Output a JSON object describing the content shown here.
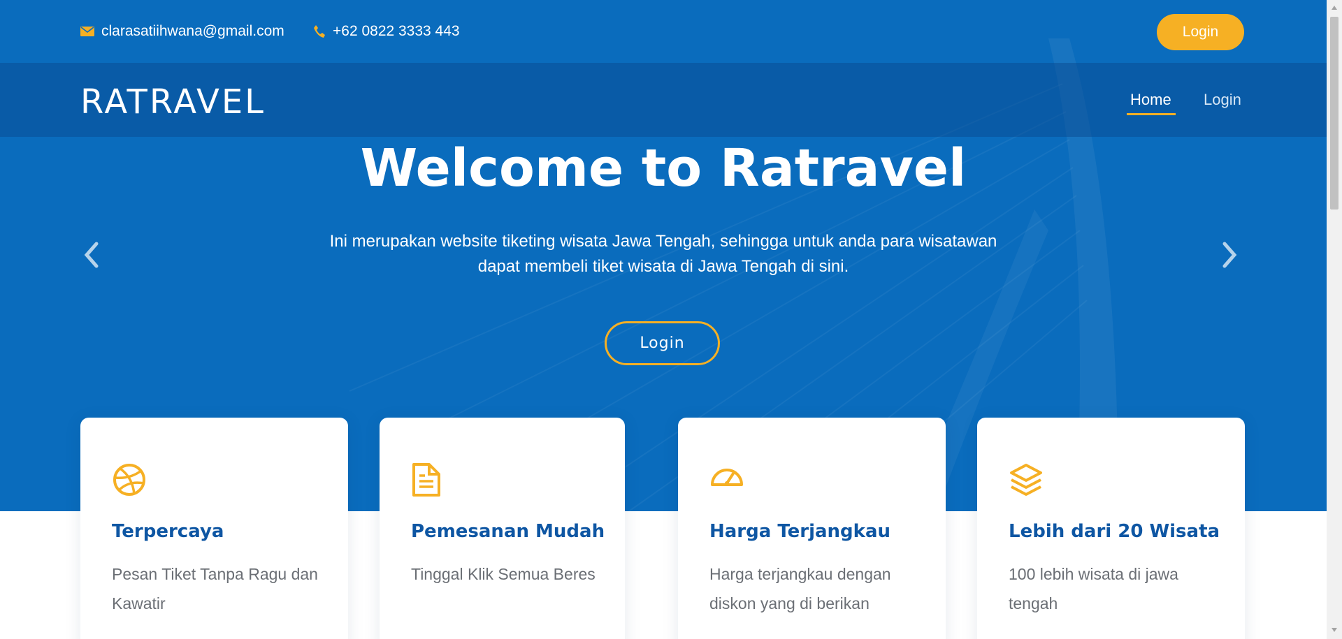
{
  "topbar": {
    "email": "clarasatiihwana@gmail.com",
    "phone": "+62 0822 3333 443",
    "login_label": "Login"
  },
  "navbar": {
    "brand": "RATRAVEL",
    "items": [
      {
        "label": "Home",
        "active": true
      },
      {
        "label": "Login",
        "active": false
      }
    ]
  },
  "hero": {
    "title": "Welcome to Ratravel",
    "subtitle": "Ini merupakan website tiketing wisata Jawa Tengah, sehingga untuk anda para wisatawan dapat membeli tiket wisata di Jawa Tengah di sini.",
    "login_label": "Login",
    "prev_icon": "chevron-left-icon",
    "next_icon": "chevron-right-icon"
  },
  "features": [
    {
      "icon": "dribbble-icon",
      "title": "Terpercaya",
      "desc": "Pesan Tiket Tanpa Ragu dan Kawatir"
    },
    {
      "icon": "file-text-icon",
      "title": "Pemesanan Mudah",
      "desc": "Tinggal Klik Semua Beres"
    },
    {
      "icon": "speedometer-icon",
      "title": "Harga Terjangkau",
      "desc": "Harga terjangkau dengan diskon yang di berikan"
    },
    {
      "icon": "layers-icon",
      "title": "Lebih dari 20 Wisata",
      "desc": "100 lebih wisata di jawa tengah"
    }
  ],
  "colors": {
    "primary": "#0a6cbd",
    "accent": "#f6b024",
    "heading": "#0e56a3",
    "text": "#6b6f75"
  }
}
